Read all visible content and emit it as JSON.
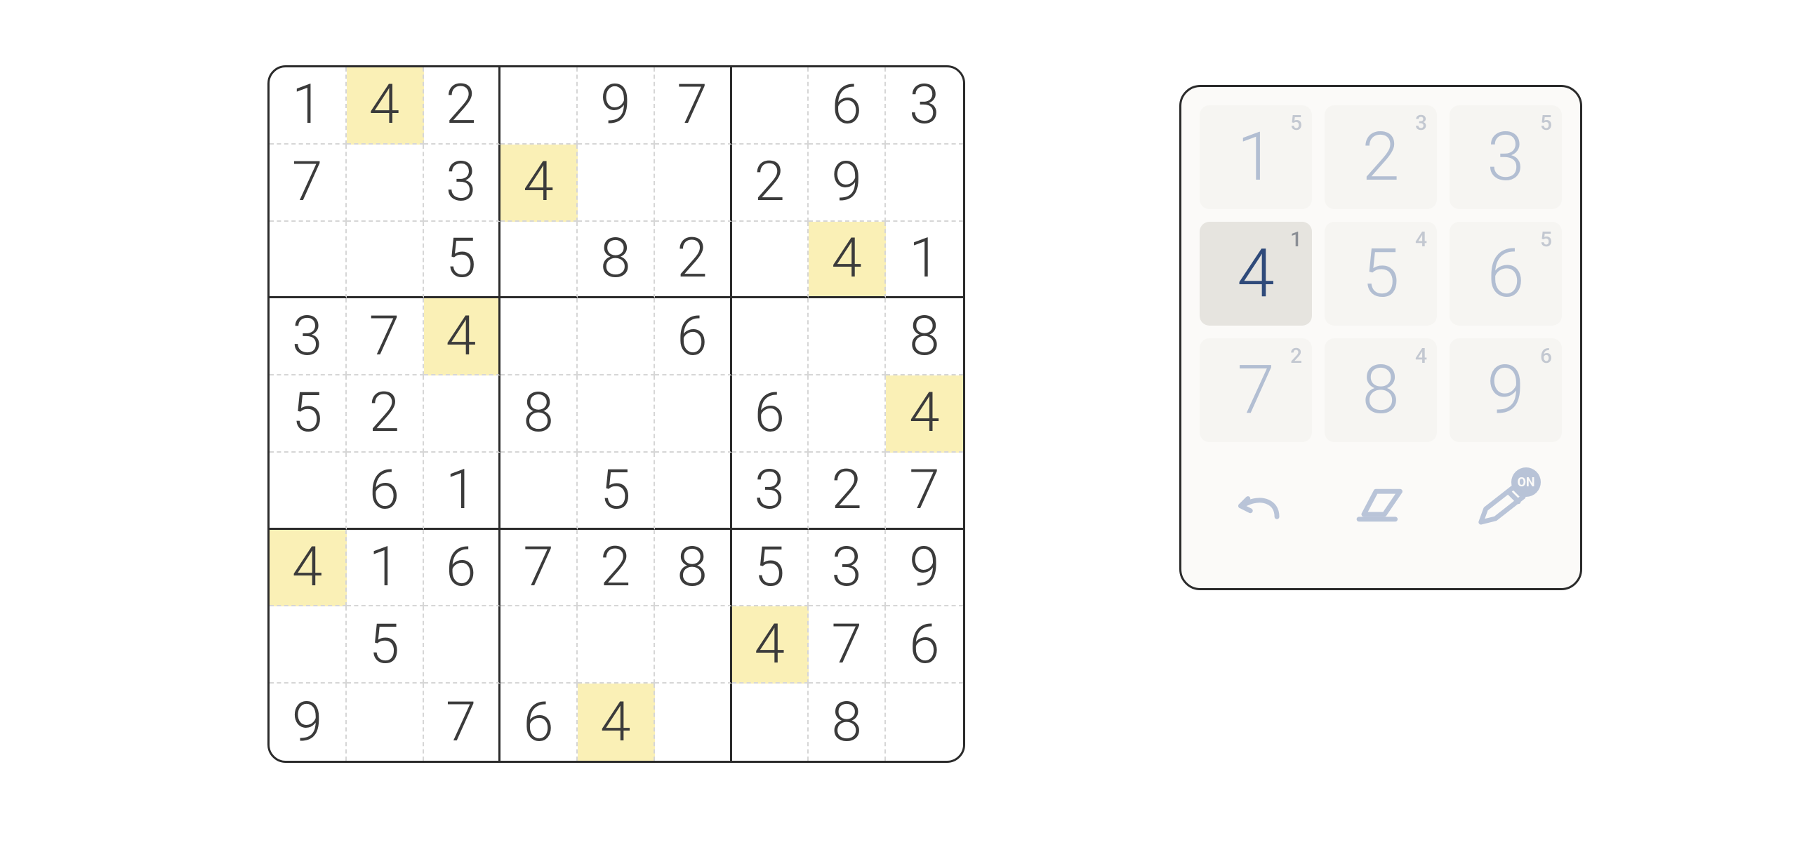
{
  "selectedNumber": 4,
  "board": [
    [
      "1",
      "4",
      "2",
      "",
      "9",
      "7",
      "",
      "6",
      "3"
    ],
    [
      "7",
      "",
      "3",
      "4",
      "",
      "",
      "2",
      "9",
      ""
    ],
    [
      "",
      "",
      "5",
      "",
      "8",
      "2",
      "",
      "4",
      "1"
    ],
    [
      "3",
      "7",
      "4",
      "",
      "",
      "6",
      "",
      "",
      "8"
    ],
    [
      "5",
      "2",
      "",
      "8",
      "",
      "",
      "6",
      "",
      "4"
    ],
    [
      "",
      "6",
      "1",
      "",
      "5",
      "",
      "3",
      "2",
      "7"
    ],
    [
      "4",
      "1",
      "6",
      "7",
      "2",
      "8",
      "5",
      "3",
      "9"
    ],
    [
      "",
      "5",
      "",
      "",
      "",
      "",
      "4",
      "7",
      "6"
    ],
    [
      "9",
      "",
      "7",
      "6",
      "4",
      "",
      "",
      "8",
      ""
    ]
  ],
  "highlights": [
    [
      0,
      1
    ],
    [
      1,
      3
    ],
    [
      2,
      7
    ],
    [
      3,
      2
    ],
    [
      4,
      8
    ],
    [
      6,
      0
    ],
    [
      7,
      6
    ],
    [
      8,
      4
    ]
  ],
  "numpad": [
    {
      "digit": "1",
      "remaining": "5"
    },
    {
      "digit": "2",
      "remaining": "3"
    },
    {
      "digit": "3",
      "remaining": "5"
    },
    {
      "digit": "4",
      "remaining": "1"
    },
    {
      "digit": "5",
      "remaining": "4"
    },
    {
      "digit": "6",
      "remaining": "5"
    },
    {
      "digit": "7",
      "remaining": "2"
    },
    {
      "digit": "8",
      "remaining": "4"
    },
    {
      "digit": "9",
      "remaining": "6"
    }
  ],
  "tools": {
    "pencilBadge": "ON"
  }
}
